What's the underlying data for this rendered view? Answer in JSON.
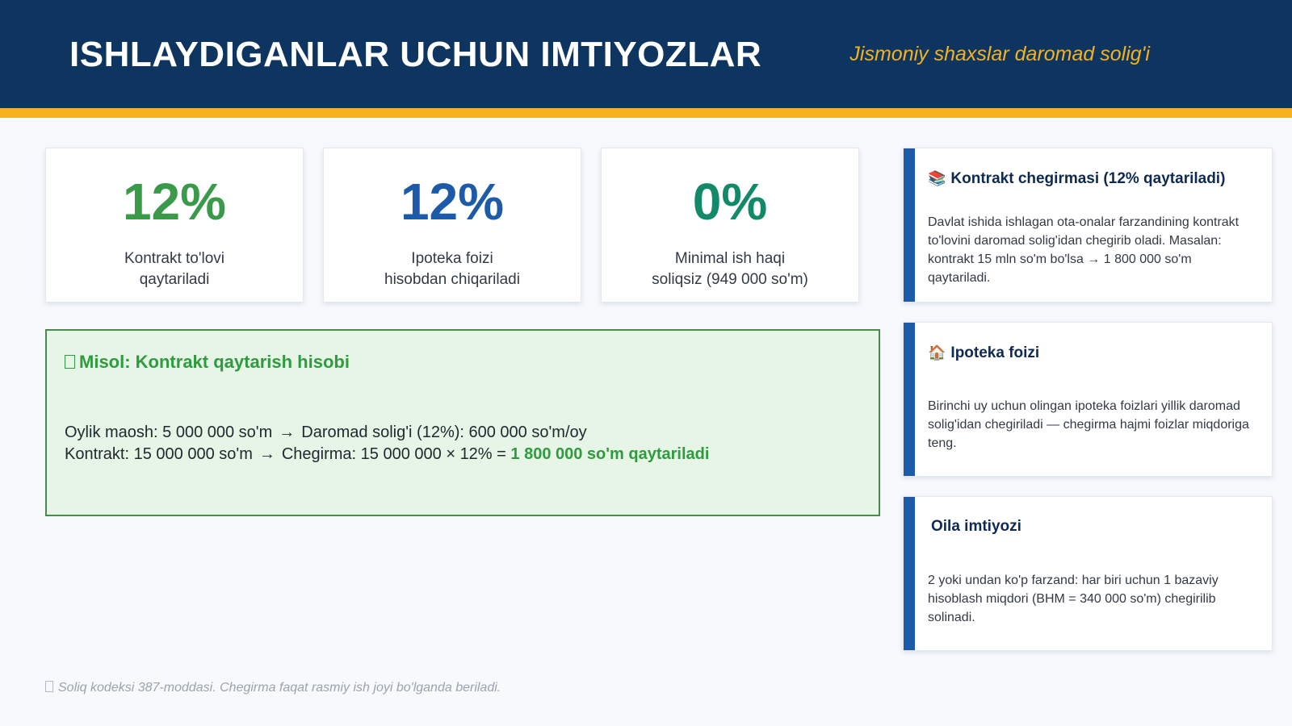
{
  "header": {
    "title": "ISHLAYDIGANLAR UCHUN IMTIYOZLAR",
    "subtitle": "Jismoniy shaxslar daromad solig'i",
    "colors": {
      "background": "#0e3560",
      "stripe": "#f5b21d"
    }
  },
  "stats": [
    {
      "value": "12%",
      "label_line1": "Kontrakt to'lovi",
      "label_line2": "qaytariladi",
      "color": "#3a9a4a"
    },
    {
      "value": "12%",
      "label_line1": "Ipoteka foizi",
      "label_line2": "hisobdan chiqariladi",
      "color": "#1d5aa8"
    },
    {
      "value": "0%",
      "label_line1": "Minimal ish haqi",
      "label_line2": "soliqsiz (949 000 so'm)",
      "color": "#128a6a"
    }
  ],
  "example": {
    "title": "Misol: Kontrakt qaytarish hisobi",
    "line1_left": "Oylik maosh: 5 000 000 so'm",
    "line1_right": "Daromad solig'i (12%): 600 000 so'm/oy",
    "line2_left": "Kontrakt: 15 000 000 so'm",
    "line2_right": "Chegirma: 15 000 000 × 12% =",
    "line2_highlight": "1 800 000 so'm qaytariladi",
    "arrow": "→"
  },
  "info_cards": [
    {
      "icon": "graduation-cap-icon",
      "glyph": "📚",
      "title": "Kontrakt chegirmasi (12% qaytariladi)",
      "body": "Davlat ishida ishlagan ota-onalar farzandining kontrakt to'lovini daromad solig'idan chegirib oladi. Masalan: kontrakt 15 mln so'm bo'lsa → 1 800 000 so'm qaytariladi."
    },
    {
      "icon": "house-icon",
      "glyph": "🏠",
      "title": "Ipoteka foizi",
      "body": "Birinchi uy uchun olingan ipoteka foizlari yillik daromad solig'idan chegiriladi — chegirma hajmi foizlar miqdoriga teng."
    },
    {
      "icon": "",
      "glyph": "",
      "title": "Oila imtiyozi",
      "body": "2 yoki undan ko'p farzand: har biri uchun 1 bazaviy hisoblash miqdori (BHM = 340 000 so'm) chegirilib solinadi."
    }
  ],
  "footnote": "Soliq kodeksi 387-moddasi. Chegirma faqat rasmiy ish joyi bo'lganda beriladi."
}
